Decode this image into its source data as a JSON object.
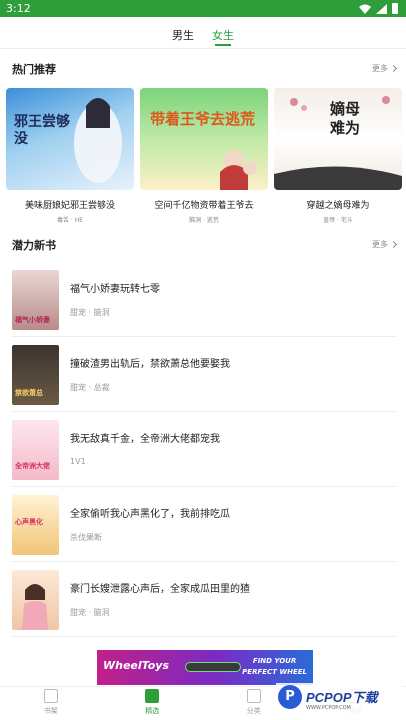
{
  "status_bar": {
    "time": "3:12"
  },
  "gender_tabs": [
    {
      "label": "男生",
      "active": false
    },
    {
      "label": "女生",
      "active": true
    }
  ],
  "hot": {
    "title": "热门推荐",
    "more": "更多",
    "books": [
      {
        "title": "美味厨娘妃邪王尝够没",
        "meta": "毒舌 · HE",
        "cover_text": "邪王尝够没"
      },
      {
        "title": "空间千亿物资带着王爷去",
        "meta": "脑洞 · 逃荒",
        "cover_text": "带着王爷去逃荒"
      },
      {
        "title": "穿越之嫡母难为",
        "meta": "皇帝 · 宅斗",
        "cover_text": "嫡母难为"
      }
    ]
  },
  "potential": {
    "title": "潜力新书",
    "more": "更多",
    "books": [
      {
        "title": "福气小娇妻玩转七零",
        "tags": "甜宠 · 脑洞",
        "cover_text": "福气小娇妻"
      },
      {
        "title": "撞破渣男出轨后，禁欲萧总他要娶我",
        "tags": "甜宠 · 总裁",
        "cover_text": "禁欲萧总"
      },
      {
        "title": "我无敌真千金，全帝洲大佬都宠我",
        "tags": "1V1",
        "cover_text": "全帝洲大佬"
      },
      {
        "title": "全家偷听我心声黑化了，我前排吃瓜",
        "tags": "杀伐果断",
        "cover_text": "心声黑化"
      },
      {
        "title": "豪门长嫂泄露心声后，全家成瓜田里的猹",
        "tags": "甜宠 · 脑洞",
        "cover_text": ""
      }
    ]
  },
  "ad": {
    "brand": "WheelToys",
    "tagline_1": "FIND YOUR",
    "tagline_2": "PERFECT WHEEL"
  },
  "tabbar": [
    {
      "label": "书架",
      "active": false
    },
    {
      "label": "精选",
      "active": true
    },
    {
      "label": "分类",
      "active": false
    },
    {
      "label": "搜索",
      "active": false
    }
  ],
  "watermark": {
    "logo_letter": "P",
    "text": "PCPOP下载",
    "sub": "WWW.PCPOP.COM"
  },
  "colors": {
    "accent": "#2e9d3a"
  }
}
